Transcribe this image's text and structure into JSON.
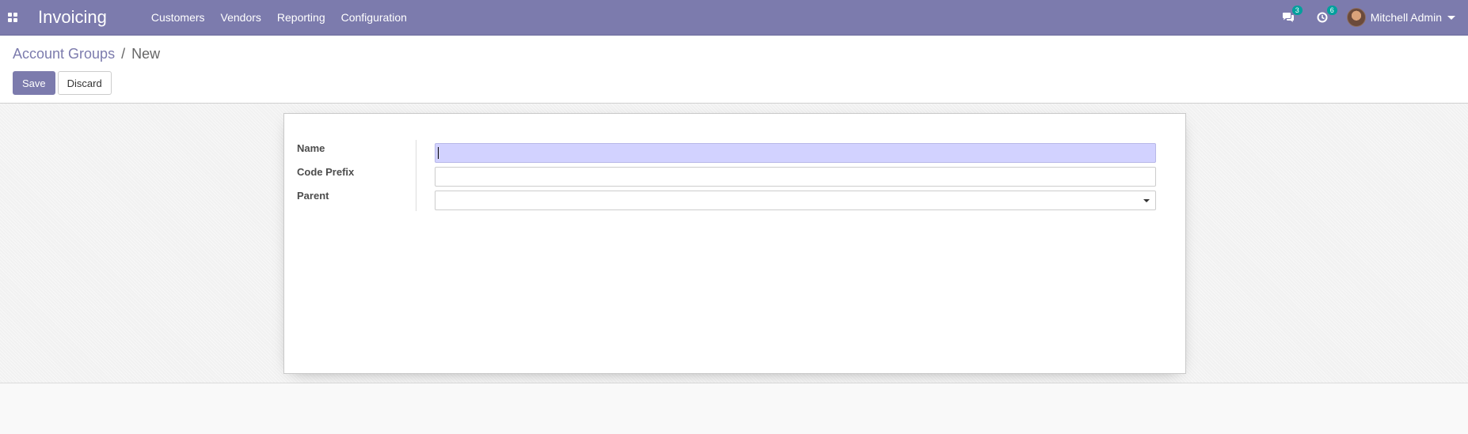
{
  "navbar": {
    "app_name": "Invoicing",
    "menu": [
      "Customers",
      "Vendors",
      "Reporting",
      "Configuration"
    ],
    "messages_count": "3",
    "activities_count": "6",
    "user_name": "Mitchell Admin"
  },
  "breadcrumb": {
    "parent": "Account Groups",
    "separator": "/",
    "current": "New"
  },
  "actions": {
    "save_label": "Save",
    "discard_label": "Discard"
  },
  "form": {
    "name_label": "Name",
    "name_value": "",
    "code_prefix_label": "Code Prefix",
    "code_prefix_value": "",
    "parent_label": "Parent",
    "parent_value": ""
  },
  "colors": {
    "brand": "#7c7bad",
    "badge": "#00a09d",
    "focused_input": "#d2d2ff"
  }
}
